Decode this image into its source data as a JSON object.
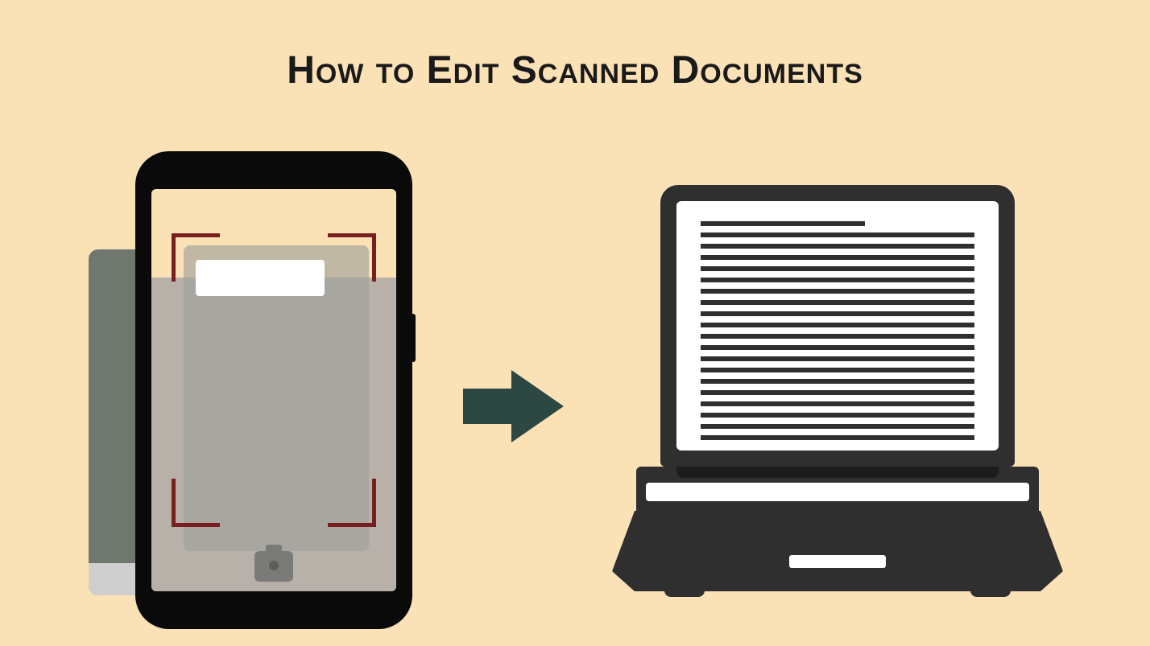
{
  "title": "How to Edit Scanned Documents",
  "colors": {
    "background": "#fbe1b6",
    "heading": "#1a1a1a",
    "arrow": "#2d4843",
    "bracket": "#7a1f1f",
    "device": "#2f2f2f"
  },
  "illustration": {
    "left": "phone-scanning-book",
    "middle": "arrow-right",
    "right": "laptop-with-document"
  }
}
